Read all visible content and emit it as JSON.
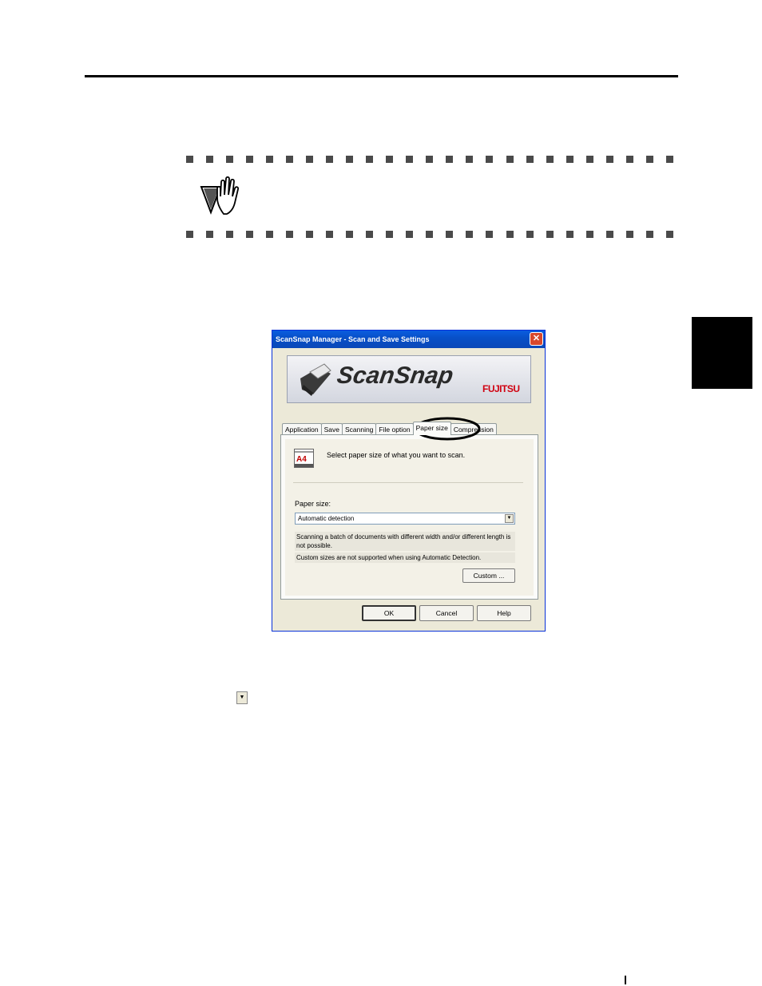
{
  "dialog": {
    "title": "ScanSnap Manager - Scan and Save Settings",
    "close_glyph": "✕",
    "banner": {
      "brand": "ScanSnap",
      "maker": "FUJITSU"
    },
    "tabs": [
      {
        "label": "Application"
      },
      {
        "label": "Save"
      },
      {
        "label": "Scanning"
      },
      {
        "label": "File option"
      },
      {
        "label": "Paper size",
        "active": true
      },
      {
        "label": "Compression"
      }
    ],
    "panel": {
      "icon_text": "A4",
      "instruction": "Select paper size of what you want to scan.",
      "paper_size_label": "Paper size:",
      "paper_size_value": "Automatic detection",
      "note1": "Scanning a batch of documents with different width and/or different length is not possible.",
      "note2": "Custom sizes are not supported when using Automatic Detection.",
      "custom_button": "Custom ..."
    },
    "buttons": {
      "ok": "OK",
      "cancel": "Cancel",
      "help": "Help"
    }
  },
  "page": {
    "dropdown_glyph": "▼",
    "icons": {
      "important": "hand-stop-icon"
    }
  }
}
